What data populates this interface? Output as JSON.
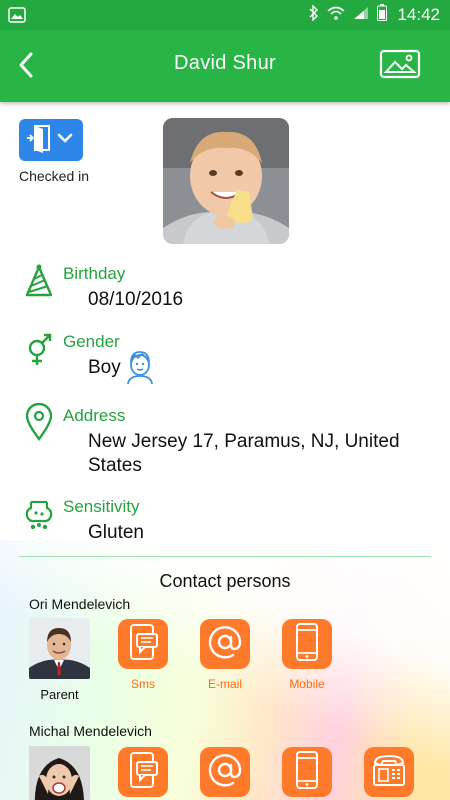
{
  "status": {
    "time": "14:42"
  },
  "header": {
    "title": "David Shur"
  },
  "checkin": {
    "label": "Checked in"
  },
  "fields": {
    "birthday": {
      "label": "Birthday",
      "value": "08/10/2016"
    },
    "gender": {
      "label": "Gender",
      "value": "Boy"
    },
    "address": {
      "label": "Address",
      "value_line1": "New Jersey 17, Paramus, NJ, United",
      "value_line2": "States"
    },
    "sensitivity": {
      "label": "Sensitivity",
      "value": "Gluten"
    }
  },
  "contacts": {
    "title": "Contact persons",
    "people": [
      {
        "name": "Ori Mendelevich",
        "role": "Parent",
        "actions": [
          "Sms",
          "E-mail",
          "Mobile"
        ]
      },
      {
        "name": "Michal Mendelevich"
      }
    ]
  },
  "colors": {
    "primary_green": "#28b546",
    "accent_orange": "#ff7a2a",
    "checkin_blue": "#2f86e9"
  },
  "icons": [
    "back-arrow-icon",
    "gallery-icon",
    "door-checkin-icon",
    "party-hat-icon",
    "gender-icon",
    "boy-face-icon",
    "location-pin-icon",
    "allergy-icon",
    "sms-icon",
    "email-icon",
    "mobile-icon",
    "landline-icon"
  ]
}
